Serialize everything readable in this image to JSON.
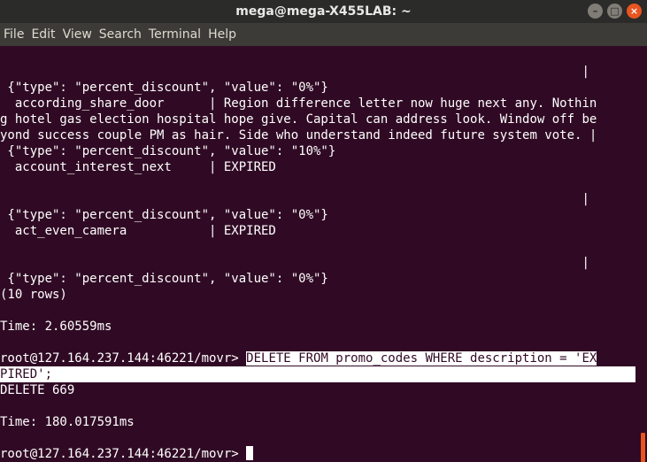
{
  "window": {
    "title": "mega@mega-X455LAB: ~",
    "buttons": {
      "minimize": "–",
      "maximize": "□",
      "close": "×"
    }
  },
  "menu": [
    "File",
    "Edit",
    "View",
    "Search",
    "Terminal",
    "Help"
  ],
  "terminal": {
    "lines": [
      "                                                                              |",
      " {\"type\": \"percent_discount\", \"value\": \"0%\"}",
      "  according_share_door      | Region difference letter now huge next any. Nothin",
      "g hotel gas election hospital hope give. Capital can address look. Window off be",
      "yond success couple PM as hair. Side who understand indeed future system vote. |",
      " {\"type\": \"percent_discount\", \"value\": \"10%\"}",
      "  account_interest_next     | EXPIRED",
      "",
      "                                                                              |",
      " {\"type\": \"percent_discount\", \"value\": \"0%\"}",
      "  act_even_camera           | EXPIRED",
      "",
      "                                                                              |",
      " {\"type\": \"percent_discount\", \"value\": \"0%\"}",
      "(10 rows)",
      "",
      "Time: 2.60559ms",
      "",
      "",
      "",
      "DELETE 669",
      "",
      "Time: 180.017591ms",
      "",
      ""
    ],
    "prompt": "root@127.164.237.144:46221/movr> ",
    "command_part1": "DELETE FROM promo_codes WHERE description = 'EX",
    "command_part2": "PIRED';",
    "final_prompt": "root@127.164.237.144:46221/movr> "
  },
  "colors": {
    "background": "#300a24",
    "titlebar": "#2b2b29",
    "menubar": "#3c3b37",
    "accent": "#e95420",
    "text": "#ffffff"
  }
}
